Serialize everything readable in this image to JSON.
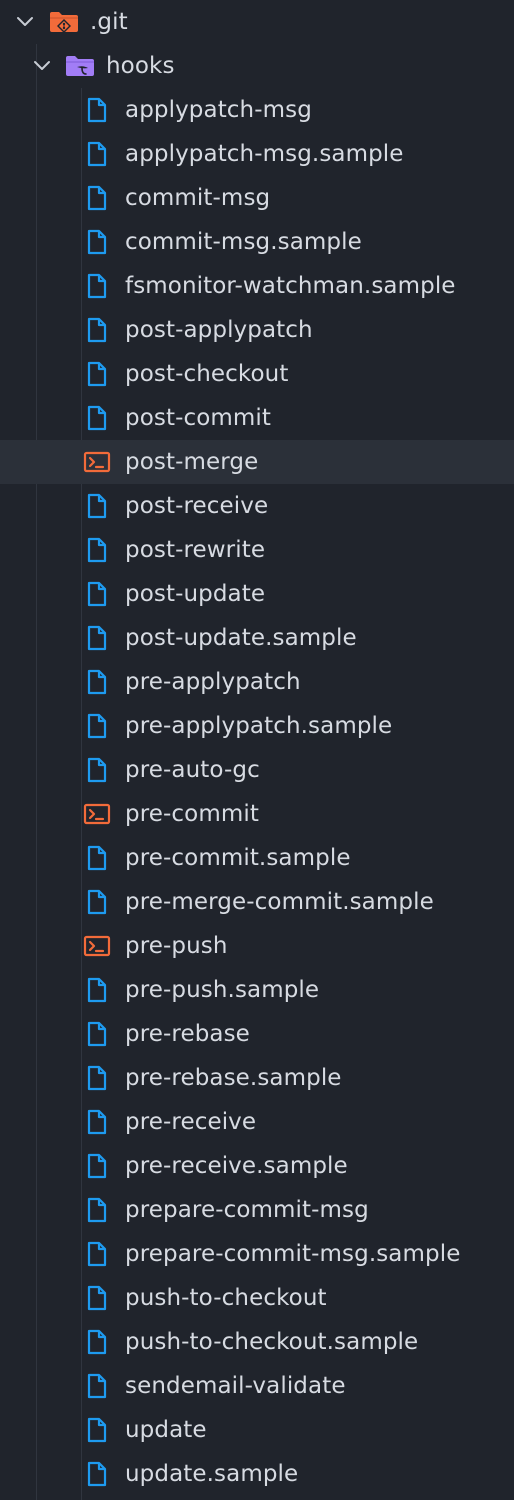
{
  "explorer": {
    "root_folder": {
      "name": ".git",
      "expanded": true,
      "icon": "git-folder-icon",
      "color": "#f26b3a"
    },
    "sub_folder": {
      "name": "hooks",
      "expanded": true,
      "icon": "hooks-folder-icon",
      "color": "#a27df6"
    },
    "colors": {
      "background": "#20242c",
      "selected_row": "#2b3039",
      "text": "#d7dbe2",
      "file_icon": "#1e9bf0",
      "shell_icon": "#f26b3a"
    },
    "files": [
      {
        "name": "applypatch-msg",
        "icon": "file-icon"
      },
      {
        "name": "applypatch-msg.sample",
        "icon": "file-icon"
      },
      {
        "name": "commit-msg",
        "icon": "file-icon"
      },
      {
        "name": "commit-msg.sample",
        "icon": "file-icon"
      },
      {
        "name": "fsmonitor-watchman.sample",
        "icon": "file-icon"
      },
      {
        "name": "post-applypatch",
        "icon": "file-icon"
      },
      {
        "name": "post-checkout",
        "icon": "file-icon"
      },
      {
        "name": "post-commit",
        "icon": "file-icon"
      },
      {
        "name": "post-merge",
        "icon": "terminal-icon",
        "selected": true
      },
      {
        "name": "post-receive",
        "icon": "file-icon"
      },
      {
        "name": "post-rewrite",
        "icon": "file-icon"
      },
      {
        "name": "post-update",
        "icon": "file-icon"
      },
      {
        "name": "post-update.sample",
        "icon": "file-icon"
      },
      {
        "name": "pre-applypatch",
        "icon": "file-icon"
      },
      {
        "name": "pre-applypatch.sample",
        "icon": "file-icon"
      },
      {
        "name": "pre-auto-gc",
        "icon": "file-icon"
      },
      {
        "name": "pre-commit",
        "icon": "terminal-icon"
      },
      {
        "name": "pre-commit.sample",
        "icon": "file-icon"
      },
      {
        "name": "pre-merge-commit.sample",
        "icon": "file-icon"
      },
      {
        "name": "pre-push",
        "icon": "terminal-icon"
      },
      {
        "name": "pre-push.sample",
        "icon": "file-icon"
      },
      {
        "name": "pre-rebase",
        "icon": "file-icon"
      },
      {
        "name": "pre-rebase.sample",
        "icon": "file-icon"
      },
      {
        "name": "pre-receive",
        "icon": "file-icon"
      },
      {
        "name": "pre-receive.sample",
        "icon": "file-icon"
      },
      {
        "name": "prepare-commit-msg",
        "icon": "file-icon"
      },
      {
        "name": "prepare-commit-msg.sample",
        "icon": "file-icon"
      },
      {
        "name": "push-to-checkout",
        "icon": "file-icon"
      },
      {
        "name": "push-to-checkout.sample",
        "icon": "file-icon"
      },
      {
        "name": "sendemail-validate",
        "icon": "file-icon"
      },
      {
        "name": "update",
        "icon": "file-icon"
      },
      {
        "name": "update.sample",
        "icon": "file-icon"
      }
    ]
  }
}
